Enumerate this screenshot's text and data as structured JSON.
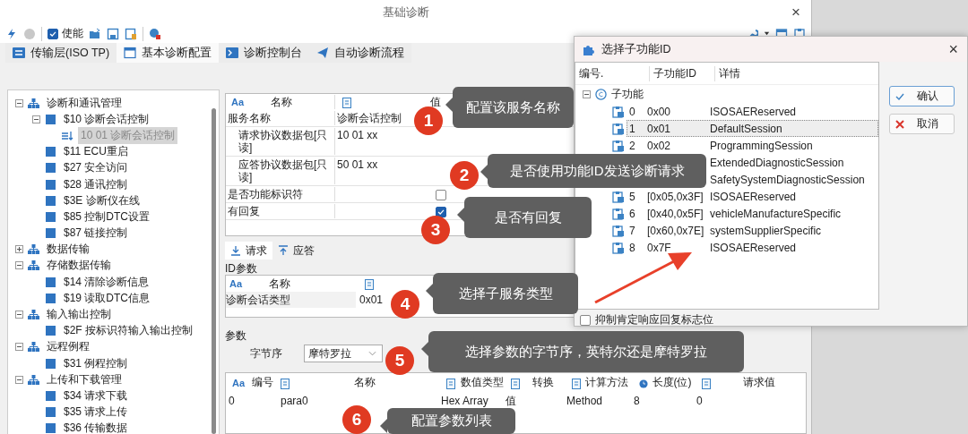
{
  "window": {
    "title": "基础诊断",
    "close": "×"
  },
  "toolbar": {
    "enable": {
      "label": "使能",
      "checked": true
    }
  },
  "tabs": [
    {
      "label": "传输层(ISO TP)",
      "selected": false
    },
    {
      "label": "基本诊断配置",
      "selected": true
    },
    {
      "label": "诊断控制台",
      "selected": false
    },
    {
      "label": "自动诊断流程",
      "selected": false
    }
  ],
  "sidebar": {
    "items": [
      {
        "kind": "group",
        "label": "诊断和通讯管理",
        "expanded": true,
        "selected": false,
        "children": [
          {
            "kind": "service",
            "label": "$10 诊断会话控制",
            "expanded": true,
            "selected": false,
            "children": [
              {
                "kind": "subfunction",
                "label": "10 01 诊断会话控制",
                "selected": true
              }
            ]
          },
          {
            "kind": "service",
            "label": "$11 ECU重启",
            "selected": false
          },
          {
            "kind": "service",
            "label": "$27 安全访问",
            "selected": false
          },
          {
            "kind": "service",
            "label": "$28 通讯控制",
            "selected": false
          },
          {
            "kind": "service",
            "label": "$3E 诊断仪在线",
            "selected": false
          },
          {
            "kind": "service",
            "label": "$85 控制DTC设置",
            "selected": false
          },
          {
            "kind": "service",
            "label": "$87 链接控制",
            "selected": false
          }
        ]
      },
      {
        "kind": "group",
        "label": "数据传输",
        "expanded": false,
        "selected": false
      },
      {
        "kind": "group",
        "label": "存储数据传输",
        "expanded": true,
        "selected": false,
        "children": [
          {
            "kind": "service",
            "label": "$14 清除诊断信息",
            "selected": false
          },
          {
            "kind": "service",
            "label": "$19 读取DTC信息",
            "selected": false
          }
        ]
      },
      {
        "kind": "group",
        "label": "输入输出控制",
        "expanded": true,
        "selected": false,
        "children": [
          {
            "kind": "service",
            "label": "$2F 按标识符输入输出控制",
            "selected": false
          }
        ]
      },
      {
        "kind": "group",
        "label": "远程例程",
        "expanded": true,
        "selected": false,
        "children": [
          {
            "kind": "service",
            "label": "$31 例程控制",
            "selected": false
          }
        ]
      },
      {
        "kind": "group",
        "label": "上传和下载管理",
        "expanded": true,
        "selected": false,
        "children": [
          {
            "kind": "service",
            "label": "$34 请求下载",
            "selected": false
          },
          {
            "kind": "service",
            "label": "$35 请求上传",
            "selected": false
          },
          {
            "kind": "service",
            "label": "$36 传输数据",
            "selected": false
          }
        ]
      }
    ]
  },
  "properties": {
    "columns": [
      {
        "kind": "text",
        "icon": "Aa",
        "label": "名称"
      },
      {
        "kind": "field",
        "label": "值"
      }
    ],
    "rows": [
      {
        "kind": "text",
        "name": "服务名称",
        "value": "诊断会话控制",
        "children": [
          {
            "kind": "text",
            "name": "请求协议数据包[只读]",
            "value": "10 01 xx"
          },
          {
            "kind": "text",
            "name": "应答协议数据包[只读]",
            "value": "50 01 xx"
          }
        ]
      },
      {
        "kind": "checkbox",
        "name": "是否功能标识符",
        "checked": false
      },
      {
        "kind": "checkbox",
        "name": "有回复",
        "checked": true
      }
    ]
  },
  "subtabs": [
    {
      "label": "请求",
      "selected": true
    },
    {
      "label": "应答",
      "selected": false
    }
  ],
  "id_params": {
    "title": "ID参数",
    "columns": [
      {
        "kind": "text",
        "icon": "Aa",
        "label": "名称"
      },
      {
        "kind": "field"
      }
    ],
    "rows": [
      {
        "name": "诊断会话类型",
        "value": "0x01"
      }
    ]
  },
  "params": {
    "title": "参数",
    "byte_order": {
      "label": "字节序",
      "value": "摩特罗拉"
    },
    "columns": [
      {
        "kind": "text",
        "icon": "Aa",
        "label": "编号"
      },
      {
        "kind": "field",
        "label": "名称"
      },
      {
        "kind": "field",
        "label": "数值类型"
      },
      {
        "kind": "field",
        "label": "转换"
      },
      {
        "kind": "field",
        "label": "计算方法"
      },
      {
        "kind": "time",
        "label": "长度(位)"
      },
      {
        "kind": "field",
        "label": "请求值"
      }
    ],
    "rows": [
      [
        "0",
        "para0",
        "Hex Array",
        "值",
        "Method",
        "8",
        "0"
      ]
    ]
  },
  "dialog": {
    "title": "选择子功能ID",
    "close": "×",
    "columns": [
      "编号.",
      "子功能ID",
      "详情"
    ],
    "root": {
      "label": "子功能",
      "expanded": true
    },
    "rows": [
      {
        "number": "0",
        "id": "0x00",
        "detail": "ISOSAEReserved",
        "selected": false
      },
      {
        "number": "1",
        "id": "0x01",
        "detail": "DefaultSession",
        "selected": true
      },
      {
        "number": "2",
        "id": "0x02",
        "detail": "ProgrammingSession",
        "selected": false
      },
      {
        "detail": "ExtendedDiagnosticSession",
        "selected": false
      },
      {
        "detail": "SafetySystemDiagnosticSession",
        "selected": false
      },
      {
        "number": "5",
        "id": "[0x05,0x3F]",
        "detail": "ISOSAEReserved",
        "selected": false
      },
      {
        "number": "6",
        "id": "[0x40,0x5F]",
        "detail": "vehicleManufactureSpecific",
        "selected": false
      },
      {
        "number": "7",
        "id": "[0x60,0x7E]",
        "detail": "systemSupplierSpecific",
        "selected": false
      },
      {
        "number": "8",
        "id": "0x7F",
        "detail": "ISOSAEReserved",
        "selected": false
      }
    ],
    "buttons": [
      {
        "kind": "ok",
        "label": "确认"
      },
      {
        "kind": "cancel",
        "label": "取消"
      }
    ],
    "option": {
      "label": "抑制肯定响应回复标志位",
      "checked": false
    }
  },
  "annotations": [
    {
      "number": "1",
      "text": "配置该服务名称"
    },
    {
      "number": "2",
      "text": "是否使用功能ID发送诊断请求"
    },
    {
      "number": "3",
      "text": "是否有回复"
    },
    {
      "number": "4",
      "text": "选择子服务类型"
    },
    {
      "number": "5",
      "text": "选择参数的字节序，英特尔还是摩特罗拉"
    },
    {
      "number": "6",
      "text": "配置参数列表"
    }
  ]
}
